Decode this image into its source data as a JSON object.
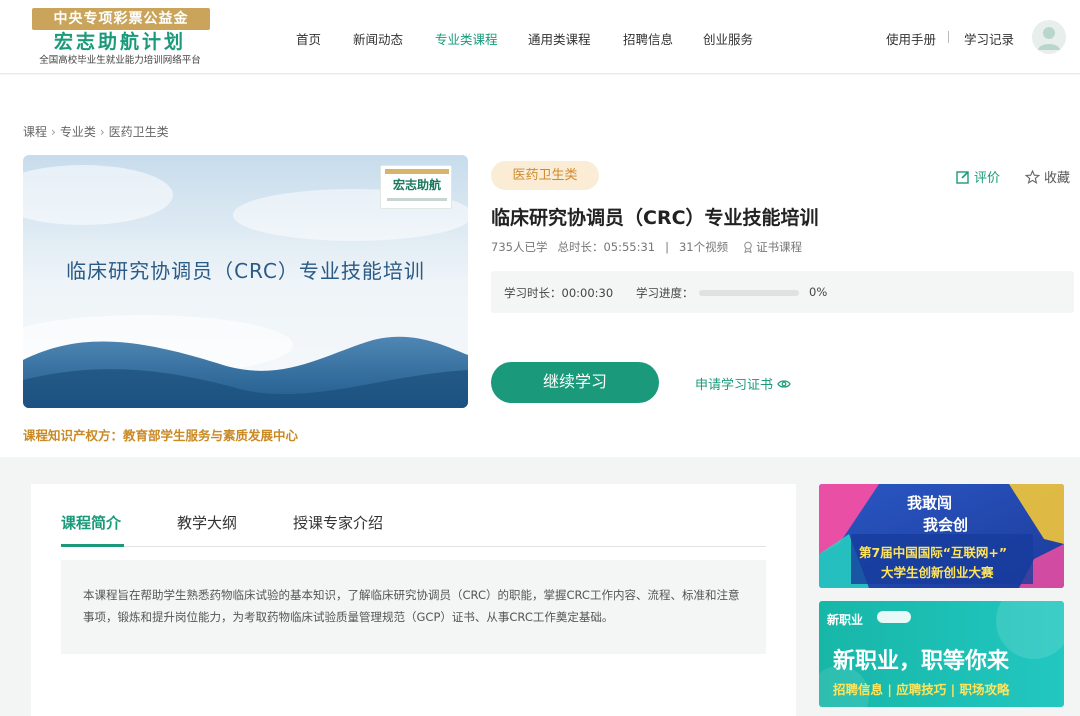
{
  "header": {
    "logo": {
      "top": "中央专项彩票公益金",
      "main": "宏志助航计划",
      "sub": "全国高校毕业生就业能力培训网络平台"
    },
    "nav": [
      "首页",
      "新闻动态",
      "专业类课程",
      "通用类课程",
      "招聘信息",
      "创业服务"
    ],
    "active_nav": "专业类课程",
    "manual": "使用手册",
    "history": "学习记录"
  },
  "breadcrumb": [
    "课程",
    "专业类",
    "医药卫生类"
  ],
  "course": {
    "cover_title": "临床研究协调员（CRC）专业技能培训",
    "cover_badge": "宏志助航",
    "tag": "医药卫生类",
    "review": "评价",
    "favorite": "收藏",
    "title": "临床研究协调员（CRC）专业技能培训",
    "learners": "735人已学",
    "duration": "总时长：05:55:31",
    "videos": "31个视频",
    "cert_course": "证书课程",
    "study_time": "学习时长：00:00:30",
    "progress_label": "学习进度：",
    "progress_pct": "0%",
    "progress_value": 0,
    "continue_btn": "继续学习",
    "apply_cert": "申请学习证书",
    "rights": "课程知识产权方：教育部学生服务与素质发展中心"
  },
  "tabs": [
    "课程简介",
    "教学大纲",
    "授课专家介绍"
  ],
  "description": "本课程旨在帮助学生熟悉药物临床试验的基本知识，了解临床研究协调员（CRC）的职能，掌握CRC工作内容、流程、标准和注意事项，锻炼和提升岗位能力，为考取药物临床试验质量管理规范（GCP）证书、从事CRC工作奠定基础。",
  "banners": {
    "b1_line1": "我敢闯",
    "b1_line2": "我会创",
    "b1_line3": "第7届中国国际“互联网+”",
    "b1_line4": "大学生创新创业大赛",
    "b2_brand": "新职业",
    "b2_headline": "新职业，职等你来",
    "b2_links": "招聘信息 | 应聘技巧 | 职场攻略"
  },
  "colors": {
    "accent": "#1a9a7a",
    "gold": "#c98a24",
    "tag_bg": "#fbecd6"
  }
}
